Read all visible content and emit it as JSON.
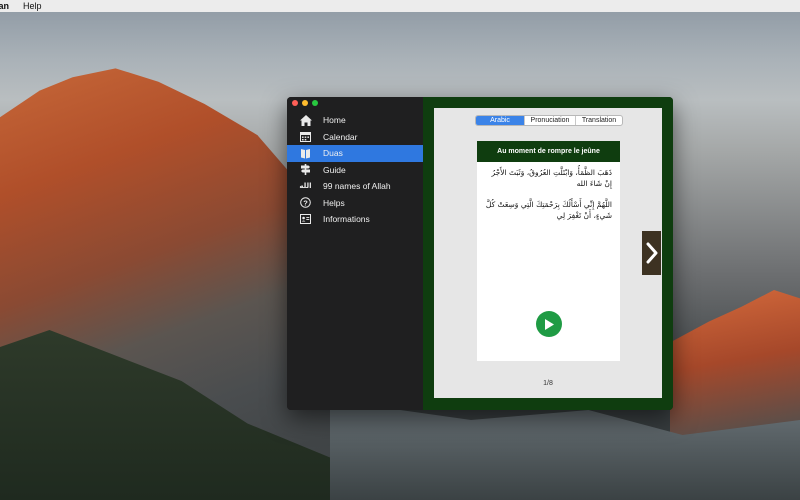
{
  "menubar": {
    "app_name": "lan",
    "help": "Help"
  },
  "sidebar": {
    "items": [
      {
        "label": "Home",
        "icon": "home-icon"
      },
      {
        "label": "Calendar",
        "icon": "calendar-icon"
      },
      {
        "label": "Duas",
        "icon": "book-icon",
        "active": true
      },
      {
        "label": "Guide",
        "icon": "signpost-icon"
      },
      {
        "label": "99 names of Allah",
        "icon": "allah-icon",
        "icon_text": "الله"
      },
      {
        "label": "Helps",
        "icon": "question-icon"
      },
      {
        "label": "Informations",
        "icon": "id-card-icon"
      }
    ]
  },
  "tabs": {
    "arabic": "Arabic",
    "pronunciation": "Pronuciation",
    "translation": "Translation"
  },
  "card": {
    "title": "Au moment de rompre le jeûne",
    "arabic_1": "ذَهَبَ الظَّمَأُ، وَابْتَلَّتِ العُرُوقُ، وَثَبَتَ الأَجْرُ إِنْ شَاءَ الله",
    "arabic_2": "اللَّهُمَّ إِنِّي أَسْأَلُكَ بِرَحْمَتِكَ الَّتِي وَسِعَتْ كُلَّ شَيءٍ، أَنْ تَغْفِرَ لِي"
  },
  "pager": {
    "text": "1/8"
  },
  "colors": {
    "accent": "#2f78e0",
    "content_bg": "#0f3d0f",
    "play": "#1f9b44"
  }
}
